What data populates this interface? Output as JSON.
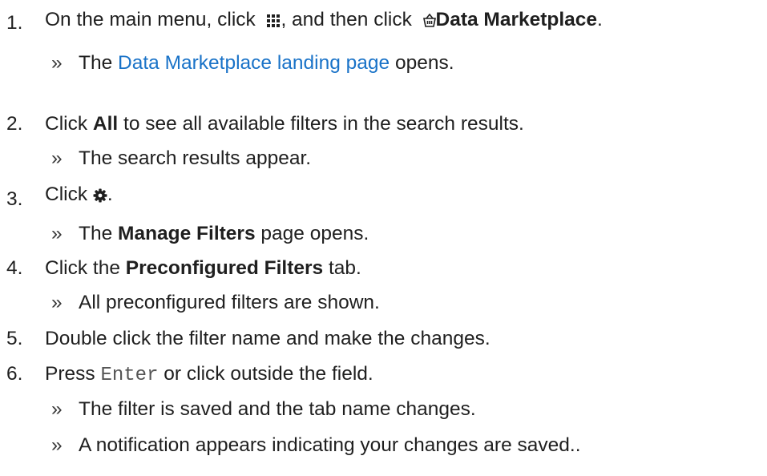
{
  "steps": [
    {
      "number": "1.",
      "parts": {
        "t1": "On the main menu, click",
        "icon1": "grid-menu-icon",
        "t2": ", and then click",
        "icon2": "basket-icon",
        "b1": "Data Marketplace",
        "t3": "."
      },
      "results": [
        {
          "bullet": "»",
          "t1": "The",
          "link": "Data Marketplace landing page",
          "t2": "opens."
        }
      ]
    },
    {
      "number": "2.",
      "parts": {
        "t1": "Click",
        "b1": "All",
        "t2": "to see all available filters in the search results."
      },
      "results": [
        {
          "bullet": "»",
          "text": "The search results appear."
        }
      ]
    },
    {
      "number": "3.",
      "parts": {
        "t1": "Click",
        "icon1": "gear-icon",
        "t2": "."
      },
      "results": [
        {
          "bullet": "»",
          "t1": "The",
          "b1": "Manage Filters",
          "t2": "page opens."
        }
      ]
    },
    {
      "number": "4.",
      "parts": {
        "t1": "Click the",
        "b1": "Preconfigured Filters",
        "t2": "tab."
      },
      "results": [
        {
          "bullet": "»",
          "text": "All preconfigured filters are shown."
        }
      ]
    },
    {
      "number": "5.",
      "parts": {
        "text": "Double click the filter name and make the changes."
      },
      "results": []
    },
    {
      "number": "6.",
      "parts": {
        "t1": "Press",
        "code": "Enter",
        "t2": "or click outside the field."
      },
      "results": [
        {
          "bullet": "»",
          "text": "The filter is saved and the tab name changes."
        },
        {
          "bullet": "»",
          "text": "A notification appears indicating your changes are saved.."
        }
      ]
    }
  ],
  "colors": {
    "text": "#1f1f1f",
    "link": "#1a73c8",
    "code": "#555555"
  }
}
